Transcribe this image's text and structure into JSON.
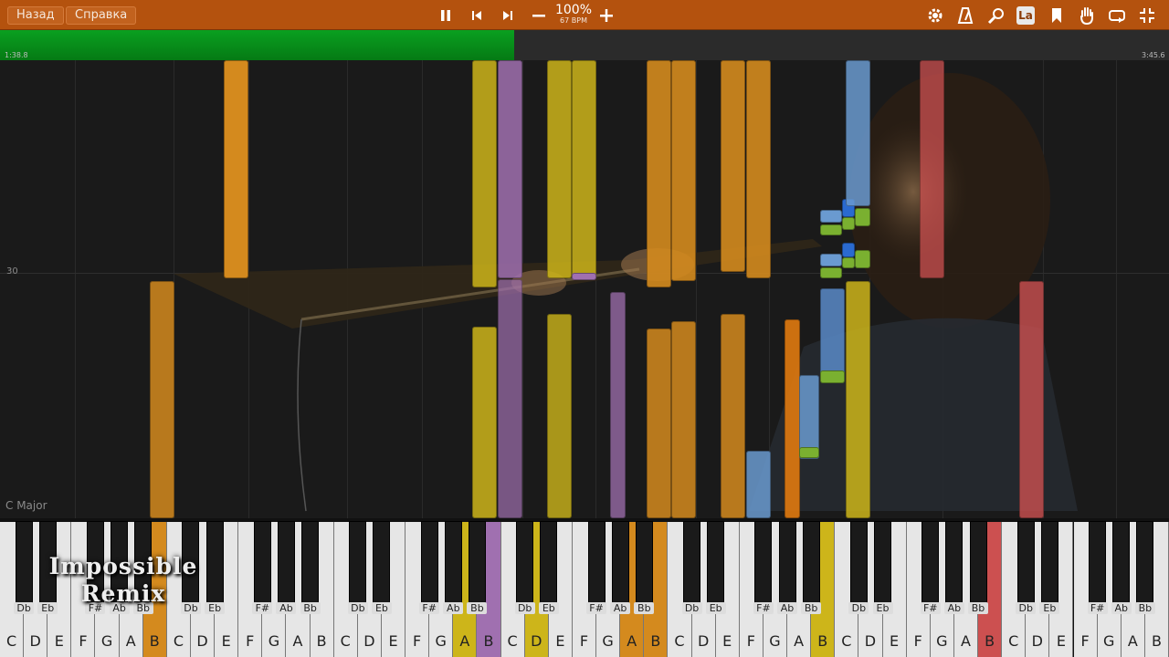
{
  "toolbar": {
    "back_label": "Назад",
    "help_label": "Справка",
    "speed_percent": "100%",
    "bpm_label": "67 BPM",
    "icons": [
      "pause-icon",
      "skip-back-icon",
      "skip-forward-icon",
      "speed-minus-icon",
      "speed-plus-icon",
      "gear-icon",
      "metronome-icon",
      "search-icon",
      "la-label-icon",
      "bookmark-icon",
      "hand-icon",
      "loop-icon",
      "collapse-icon"
    ],
    "la_label": "La",
    "accent": "#b4520e"
  },
  "progress": {
    "elapsed": "1:38.8",
    "total": "3:45.6",
    "fraction": 0.44,
    "fill_color": "#089a1c"
  },
  "roll": {
    "measure_label": "30",
    "key_signature": "C Major"
  },
  "branding": {
    "line1": "Impossible",
    "line2": "Remix"
  },
  "keyboard": {
    "white_labels": [
      "C",
      "D",
      "E",
      "F",
      "G",
      "A",
      "B",
      "C",
      "D",
      "E",
      "F",
      "G",
      "A",
      "B",
      "C",
      "D",
      "E",
      "F",
      "G",
      "A",
      "B",
      "C",
      "D",
      "E",
      "F",
      "G",
      "A",
      "B",
      "C",
      "D",
      "E",
      "F",
      "G",
      "A",
      "B",
      "C",
      "D",
      "E",
      "F",
      "G",
      "A",
      "B",
      "C",
      "D",
      "E",
      "F",
      "G",
      "A",
      "B"
    ],
    "black_labels": [
      "Db",
      "Eb",
      "F#",
      "Ab",
      "Bb",
      "Db",
      "Eb",
      "F#",
      "Ab",
      "Bb",
      "Db",
      "Eb",
      "F#",
      "Ab",
      "Bb",
      "Db",
      "Eb",
      "F#",
      "Ab",
      "Bb",
      "Db",
      "Eb",
      "F#",
      "Ab",
      "Bb",
      "Db",
      "Eb",
      "F#",
      "Ab",
      "Bb",
      "Db",
      "Eb",
      "F#",
      "Ab",
      "Bb"
    ],
    "pressed_colors": {
      "orange": "#d48a1e",
      "yellow": "#cdb51a",
      "purple": "#a070b0",
      "red": "#cc5050"
    }
  }
}
